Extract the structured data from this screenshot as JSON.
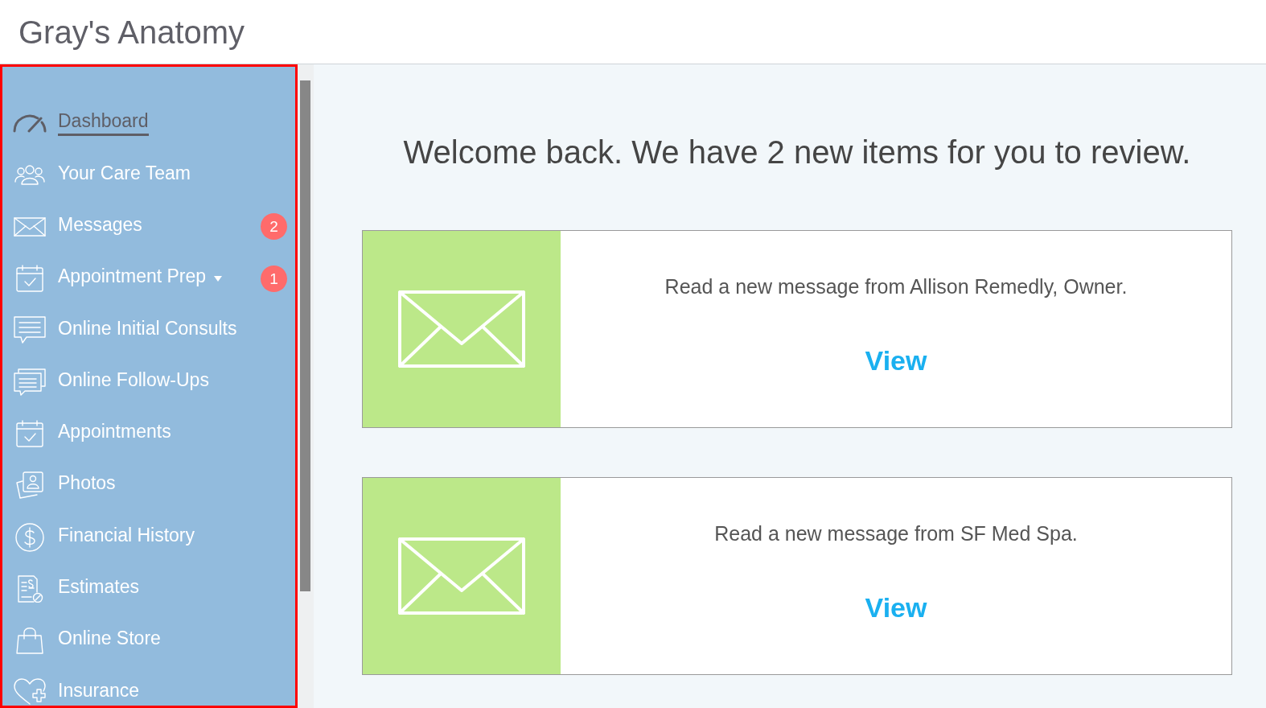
{
  "header": {
    "title": "Gray's Anatomy"
  },
  "sidebar": {
    "items": [
      {
        "label": "Dashboard",
        "selected": true
      },
      {
        "label": "Your Care Team",
        "selected": false
      },
      {
        "label": "Messages",
        "selected": false,
        "badge": "2"
      },
      {
        "label": "Appointment Prep",
        "selected": false,
        "submenu": true,
        "badge": "1"
      },
      {
        "label": "Online Initial Consults",
        "selected": false
      },
      {
        "label": "Online Follow-Ups",
        "selected": false
      },
      {
        "label": "Appointments",
        "selected": false
      },
      {
        "label": "Photos",
        "selected": false
      },
      {
        "label": "Financial History",
        "selected": false
      },
      {
        "label": "Estimates",
        "selected": false
      },
      {
        "label": "Online Store",
        "selected": false
      },
      {
        "label": "Insurance",
        "selected": false
      }
    ]
  },
  "main": {
    "welcome": "Welcome back. We have 2 new items for you to review.",
    "notifications": [
      {
        "text": "Read a new message from Allison Remedly, Owner.",
        "action": "View"
      },
      {
        "text": "Read a new message from SF Med Spa.",
        "action": "View"
      }
    ]
  }
}
